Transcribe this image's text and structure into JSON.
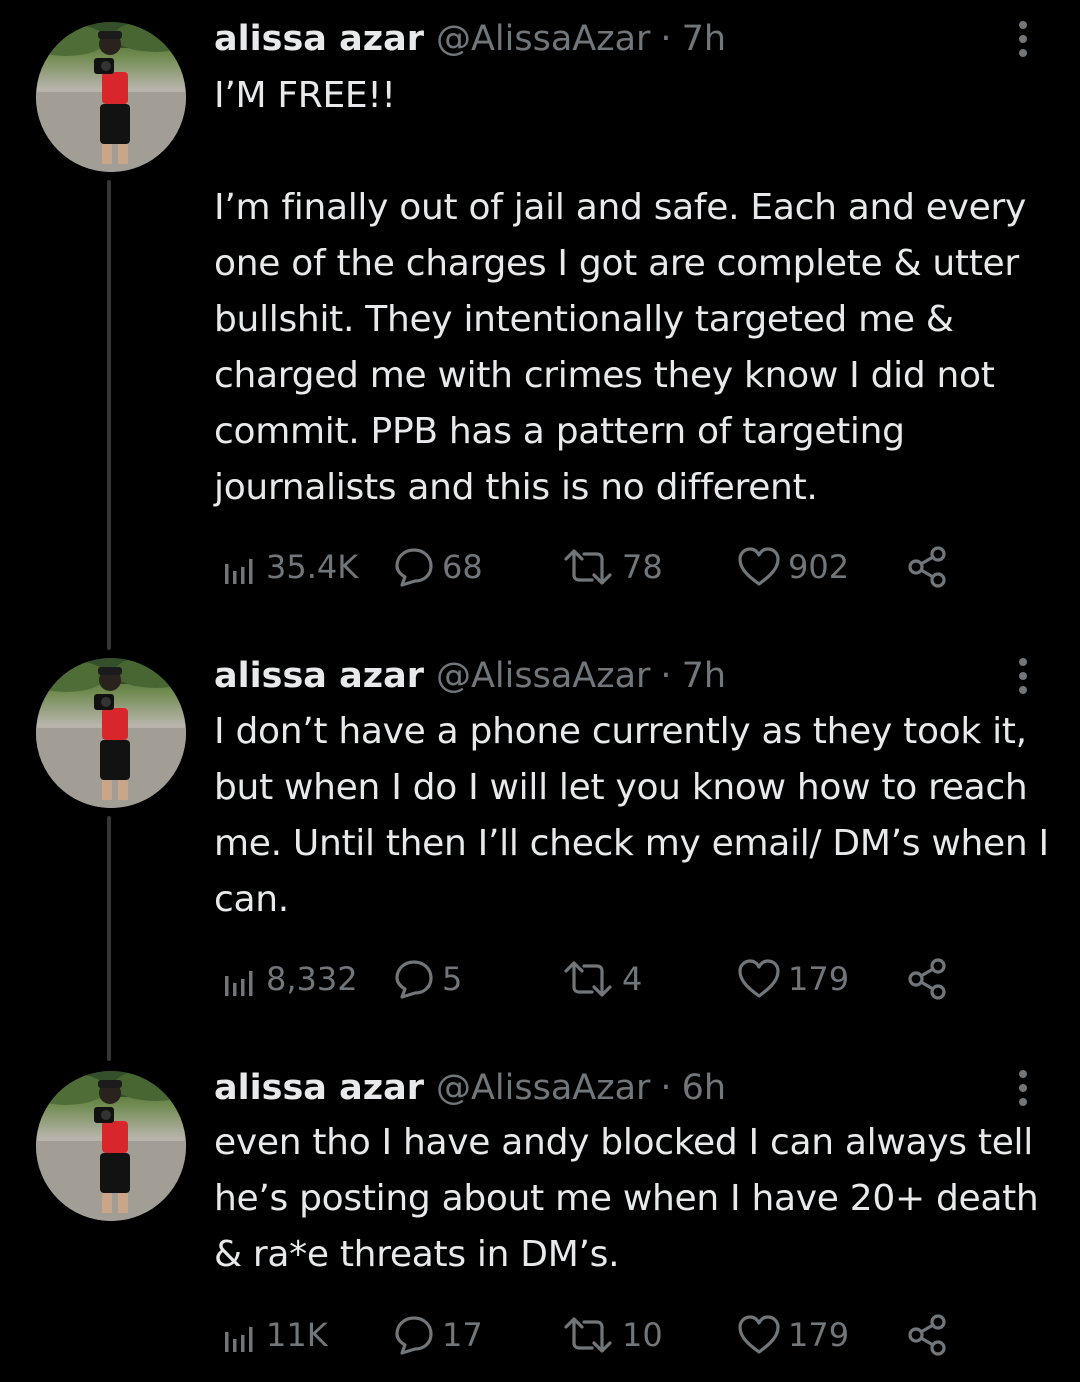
{
  "colors": {
    "background": "#000000",
    "text_primary": "#e7e9ea",
    "text_secondary": "#71767b",
    "thread_line": "#333639"
  },
  "icons": {
    "views": "bar-chart-icon",
    "reply": "speech-bubble-icon",
    "retweet": "retweet-arrows-icon",
    "like": "heart-icon",
    "share": "share-nodes-icon",
    "more": "vertical-ellipsis-icon"
  },
  "tweets": [
    {
      "name": "alissa azar",
      "handle": "@AlissaAzar",
      "separator": "·",
      "time": "7h",
      "text": "I’M FREE!!\n\nI’m finally out of jail and safe. Each and every one of the charges I got are complete & utter bullshit. They intentionally targeted me & charged me with crimes they know I did not commit. PPB has a pattern of targeting journalists and this is no different.",
      "views": "35.4K",
      "replies": "68",
      "retweets": "78",
      "likes": "902"
    },
    {
      "name": "alissa azar",
      "handle": "@AlissaAzar",
      "separator": "·",
      "time": "7h",
      "text": "I don’t have a phone currently as they took it, but when I do I will let you know how to reach me. Until then I’ll check my email/ DM’s when I can.",
      "views": "8,332",
      "replies": "5",
      "retweets": "4",
      "likes": "179"
    },
    {
      "name": "alissa azar",
      "handle": "@AlissaAzar",
      "separator": "·",
      "time": "6h",
      "text": "even tho I have andy blocked I can always tell he’s posting about me when I have 20+ death & ra*e threats in DM’s.",
      "views": "11K",
      "replies": "17",
      "retweets": "10",
      "likes": "179"
    }
  ]
}
